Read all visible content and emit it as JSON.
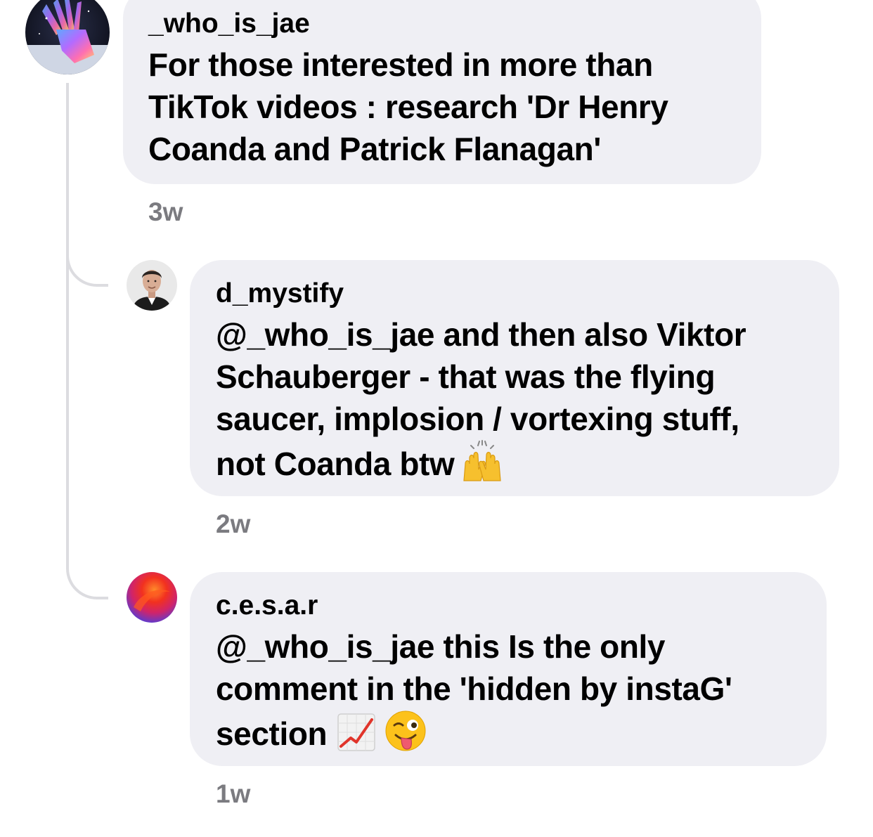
{
  "comments": [
    {
      "username": "_who_is_jae",
      "lines": [
        "For those interested in more than",
        "TikTok videos : research 'Dr Henry",
        "Coanda and Patrick Flanagan'"
      ],
      "time": "3w"
    },
    {
      "username": "d_mystify",
      "lines": [
        "@_who_is_jae and then also Viktor",
        "Schauberger - that was the flying",
        "saucer, implosion / vortexing stuff,",
        "not Coanda btw"
      ],
      "emoji": "raising-hands-emoji",
      "time": "2w"
    },
    {
      "username": "c.e.s.a.r",
      "lines": [
        "@_who_is_jae this Is the only",
        "comment in the 'hidden by instaG'",
        "section"
      ],
      "emojis": [
        "chart-increasing-emoji",
        "winking-face-tongue-emoji"
      ],
      "time": "1w"
    }
  ],
  "colors": {
    "bubble": "#efeff4",
    "timestamp": "#7b7b80",
    "thread_line": "#dcdce0"
  }
}
